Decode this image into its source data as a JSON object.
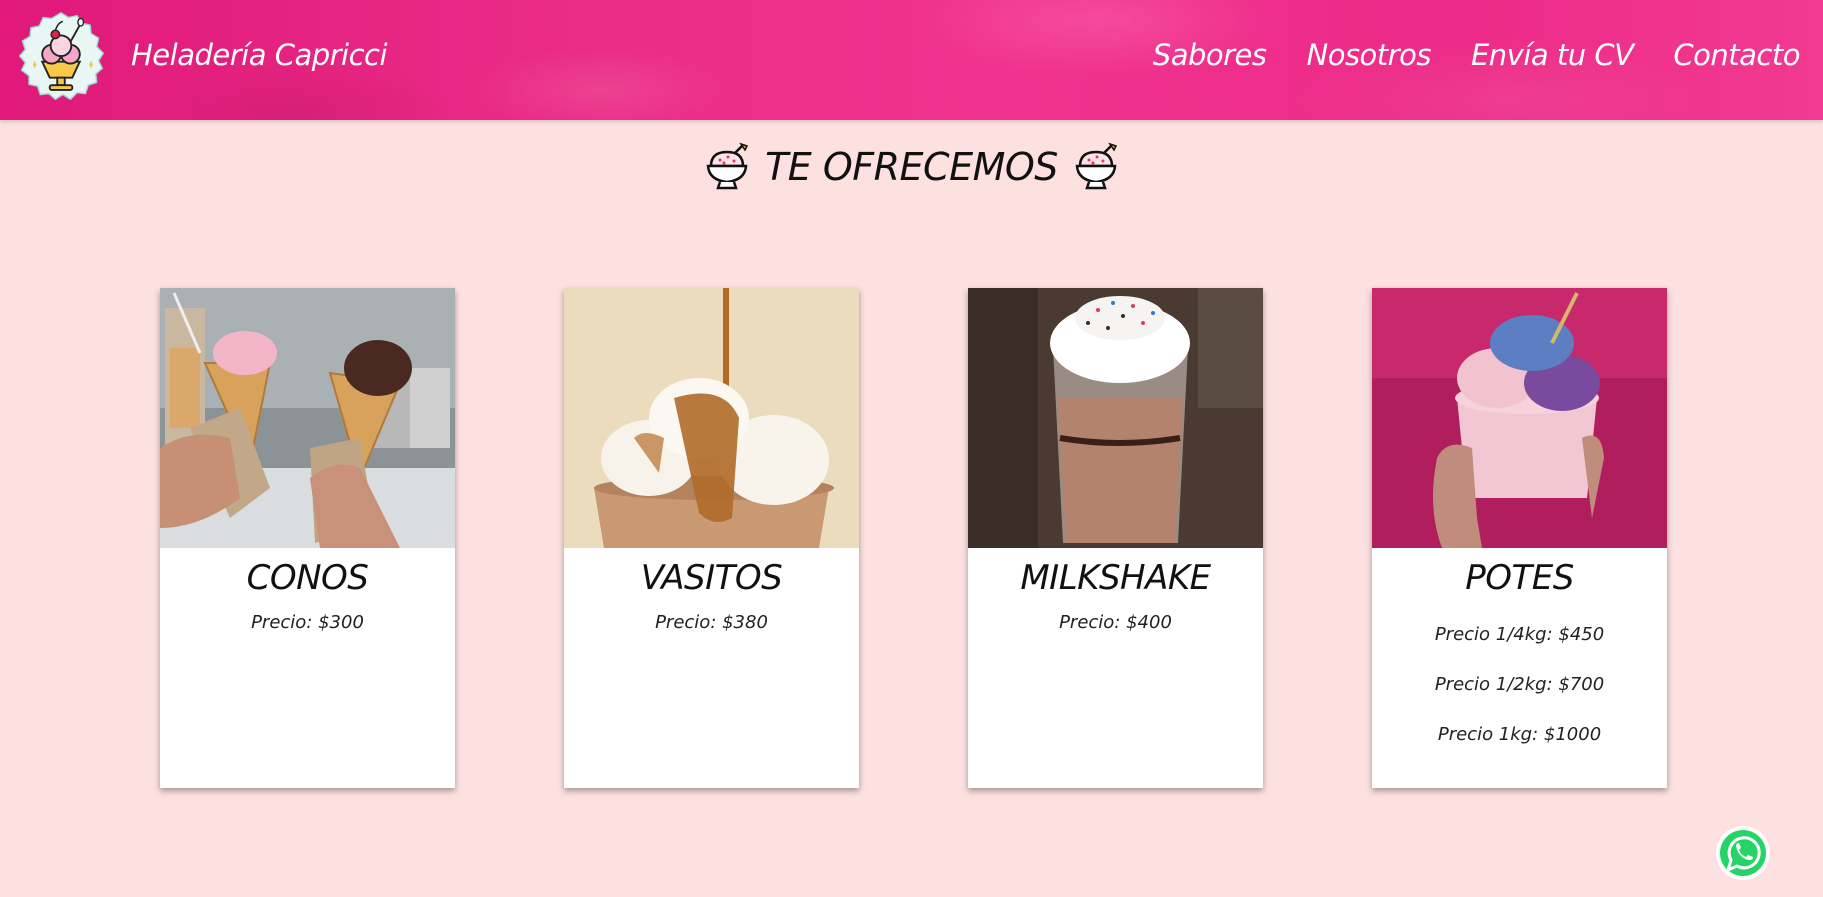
{
  "header": {
    "brand": "Heladería Capricci",
    "nav": [
      {
        "label": "Sabores"
      },
      {
        "label": "Nosotros"
      },
      {
        "label": "Envía tu CV"
      },
      {
        "label": "Contacto"
      }
    ]
  },
  "section": {
    "title": "TE OFRECEMOS"
  },
  "cards": [
    {
      "title": "CONOS",
      "prices": [
        "Precio: $300"
      ]
    },
    {
      "title": "VASITOS",
      "prices": [
        "Precio: $380"
      ]
    },
    {
      "title": "MILKSHAKE",
      "prices": [
        "Precio: $400"
      ]
    },
    {
      "title": "POTES",
      "prices": [
        "Precio 1/4kg: $450",
        "Precio 1/2kg: $700",
        "Precio 1kg: $1000"
      ]
    }
  ],
  "colors": {
    "header": "#ea2b86",
    "background": "#fde1e1",
    "card": "#ffffff",
    "whatsapp": "#25d366"
  },
  "icons": {
    "logo": "ice-cream-sundae-logo",
    "title_icon": "shaved-ice-bowl-icon",
    "floating": "whatsapp-icon"
  }
}
